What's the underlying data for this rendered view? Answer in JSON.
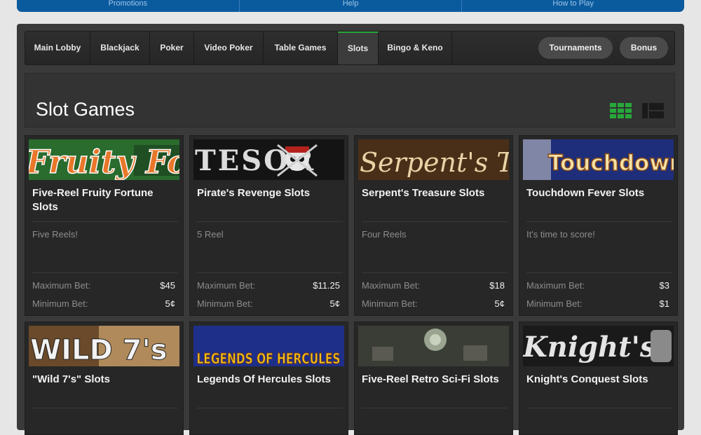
{
  "topnav": [
    "Promotions",
    "Help",
    "How to Play"
  ],
  "tabs": [
    {
      "label": "Main Lobby"
    },
    {
      "label": "Blackjack"
    },
    {
      "label": "Poker"
    },
    {
      "label": "Video Poker"
    },
    {
      "label": "Table Games"
    },
    {
      "label": "Slots",
      "active": true
    },
    {
      "label": "Bingo & Keno"
    }
  ],
  "buttons": {
    "tournaments": "Tournaments",
    "bonus": "Bonus"
  },
  "page_title": "Slot Games",
  "view_icons": [
    "grid-view-icon",
    "list-view-icon"
  ],
  "accent_color": "#26a83a",
  "labels": {
    "max_bet": "Maximum Bet:",
    "min_bet": "Minimum Bet:"
  },
  "games": [
    {
      "banner": "Fruity Fo",
      "title": "Five-Reel Fruity Fortune Slots",
      "desc": "Five Reels!",
      "max": "$45",
      "min": "5¢"
    },
    {
      "banner": "TESOR",
      "title": "Pirate's Revenge Slots",
      "desc": "5 Reel",
      "max": "$11.25",
      "min": "5¢"
    },
    {
      "banner": "Serpent's TR",
      "title": "Serpent's Treasure Slots",
      "desc": "Four Reels",
      "max": "$18",
      "min": "5¢"
    },
    {
      "banner": "Touchdown",
      "title": "Touchdown Fever Slots",
      "desc": "It's time to score!",
      "max": "$3",
      "min": "$1"
    },
    {
      "banner": "WILD 7's",
      "title": "\"Wild 7's\" Slots"
    },
    {
      "banner": "LEGENDS OF HERCULES",
      "title": "Legends Of Hercules Slots"
    },
    {
      "banner": "",
      "title": "Five-Reel Retro Sci-Fi Slots"
    },
    {
      "banner": "Knight's",
      "title": "Knight's Conquest Slots"
    }
  ]
}
